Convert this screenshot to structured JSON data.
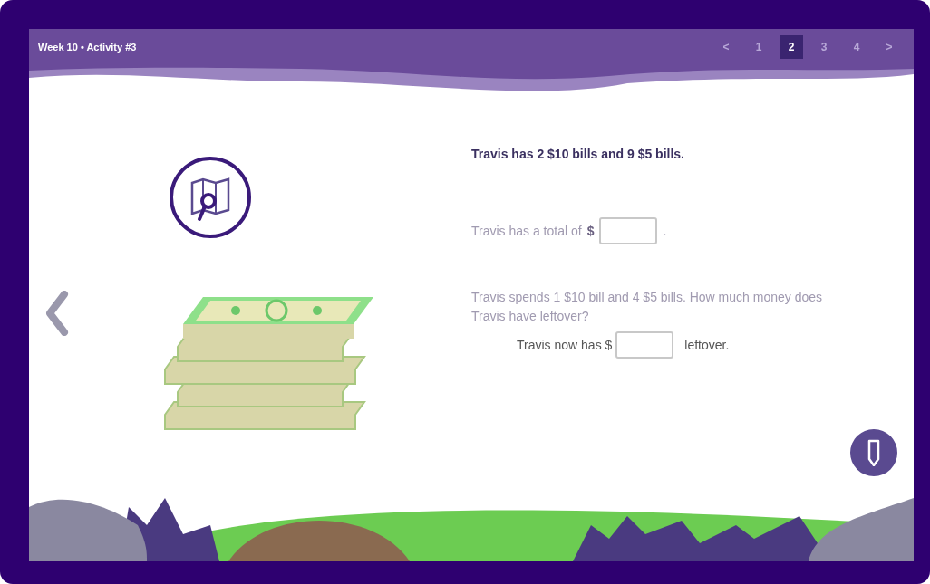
{
  "header": {
    "title": "Week 10 • Activity #3"
  },
  "pagination": {
    "prev": "<",
    "next": ">",
    "pages": [
      {
        "label": "1",
        "selected": false
      },
      {
        "label": "2",
        "selected": true
      },
      {
        "label": "3",
        "selected": false
      },
      {
        "label": "4",
        "selected": false
      }
    ]
  },
  "problem": {
    "statement": "Travis has 2 $10 bills and 9 $5 bills.",
    "questions": [
      {
        "kind": "inline",
        "prompt": "Travis has a total of",
        "before": "$",
        "after": "."
      },
      {
        "kind": "block",
        "prompt": "Travis spends 1 $10 bill and 4 $5 bills. How much money does Travis have leftover?",
        "before": "Travis now has $",
        "after": "leftover."
      }
    ]
  }
}
